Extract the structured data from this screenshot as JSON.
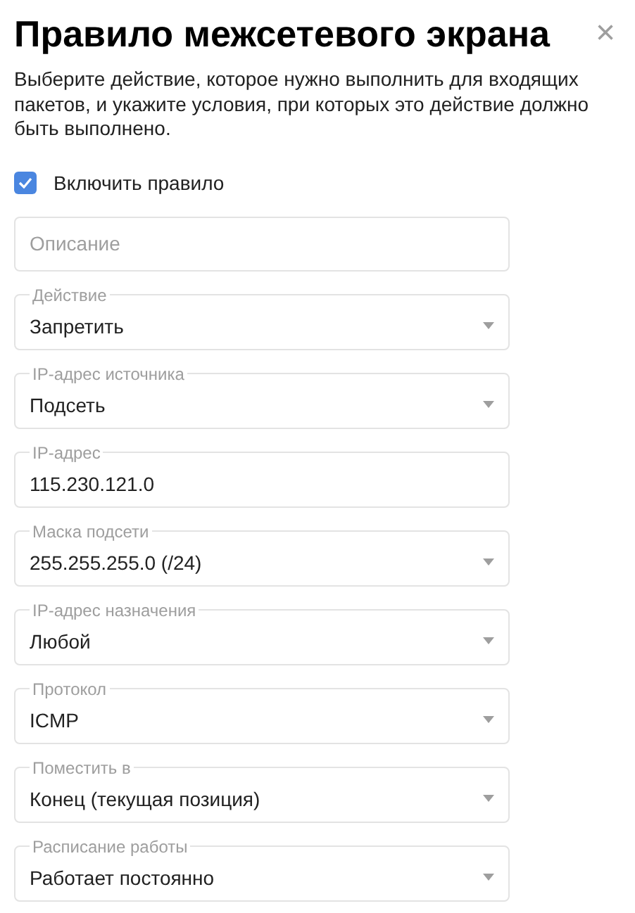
{
  "dialog": {
    "title": "Правило межсетевого экрана",
    "close": "×",
    "intro": "Выберите действие, которое нужно выполнить для входящих пакетов, и укажите условия, при которых это действие должно быть выполнено."
  },
  "enable": {
    "label": "Включить правило",
    "checked": true
  },
  "description": {
    "placeholder": "Описание"
  },
  "fields": [
    {
      "kind": "select",
      "label": "Действие",
      "value": "Запретить"
    },
    {
      "kind": "select",
      "label": "IP-адрес источника",
      "value": "Подсеть"
    },
    {
      "kind": "input",
      "label": "IP-адрес",
      "value": "115.230.121.0"
    },
    {
      "kind": "select",
      "label": "Маска подсети",
      "value": "255.255.255.0 (/24)"
    },
    {
      "kind": "select",
      "label": "IP-адрес назначения",
      "value": "Любой"
    },
    {
      "kind": "select",
      "label": "Протокол",
      "value": "ICMP"
    },
    {
      "kind": "select",
      "label": "Поместить в",
      "value": "Конец (текущая позиция)"
    },
    {
      "kind": "select",
      "label": "Расписание работы",
      "value": "Работает постоянно"
    }
  ]
}
